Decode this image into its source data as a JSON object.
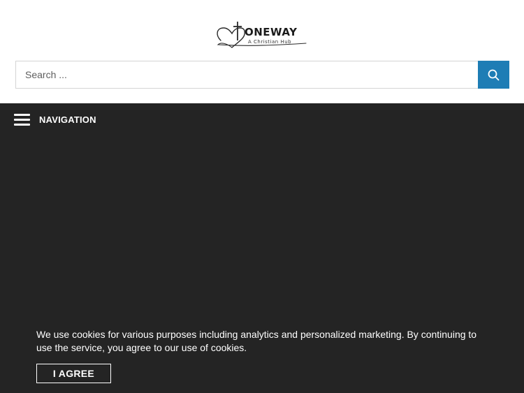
{
  "header": {
    "logo": {
      "title": "ONEWAY",
      "tagline": "A Christian Hub"
    },
    "search": {
      "placeholder": "Search ...",
      "value": "",
      "button_icon": "search-icon"
    }
  },
  "nav": {
    "toggle_icon": "hamburger-icon",
    "label": "NAVIGATION"
  },
  "cookie_banner": {
    "message": "We use cookies for various purposes including analytics and personalized marketing. By continuing to use the service, you agree to our use of cookies.",
    "accept_label": "I AGREE"
  },
  "colors": {
    "accent": "#1e7db5",
    "dark_background": "#242424",
    "page_background": "#ffffff"
  }
}
